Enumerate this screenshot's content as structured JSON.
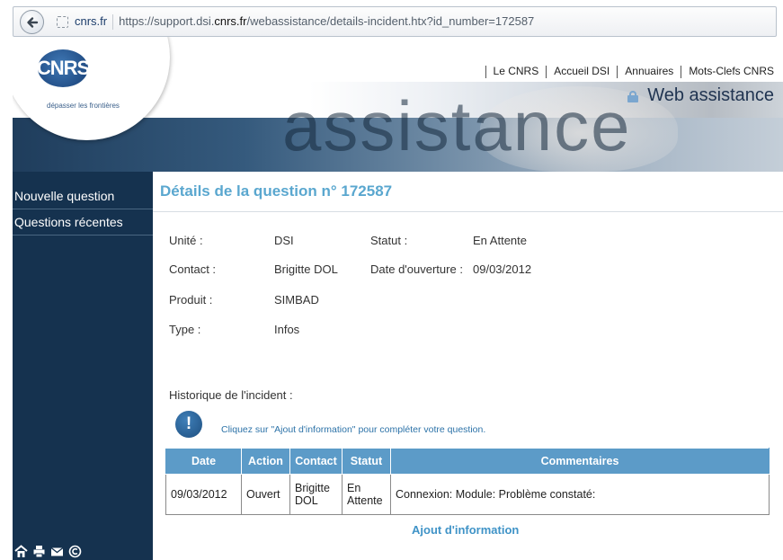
{
  "browser": {
    "domain": "cnrs.fr",
    "url_prefix": "https://support.dsi.",
    "url_bold": "cnrs.fr",
    "url_suffix": "/webassistance/details-incident.htx?id_number=172587"
  },
  "header": {
    "logo_text": "CNRS",
    "tagline": "dépasser les frontières",
    "banner_word": "assistance",
    "top_links": [
      "Le CNRS",
      "Accueil DSI",
      "Annuaires",
      "Mots-Clefs CNRS"
    ],
    "app_title": "Web assistance"
  },
  "sidebar": {
    "items": [
      {
        "label": "Nouvelle question"
      },
      {
        "label": "Questions récentes"
      }
    ],
    "footer_icons": [
      "home-icon",
      "print-icon",
      "mail-icon",
      "copyright-icon"
    ]
  },
  "main": {
    "title": "Détails de la question n° 172587",
    "fields": {
      "unite_label": "Unité :",
      "unite_value": "DSI",
      "statut_label": "Statut :",
      "statut_value": "En Attente",
      "contact_label": "Contact :",
      "contact_value": "Brigitte DOL",
      "ouverture_label": "Date d'ouverture :",
      "ouverture_value": "09/03/2012",
      "produit_label": "Produit :",
      "produit_value": "SIMBAD",
      "type_label": "Type :",
      "type_value": "Infos"
    },
    "history_label": "Historique de l'incident :",
    "info_message": "Cliquez sur \"Ajout d'information\" pour compléter votre question.",
    "table": {
      "headers": [
        "Date",
        "Action",
        "Contact",
        "Statut",
        "Commentaires"
      ],
      "rows": [
        {
          "date": "09/03/2012",
          "action": "Ouvert",
          "contact_line1": "Brigitte",
          "contact_line2": "DOL",
          "statut_line1": "En",
          "statut_line2": "Attente",
          "commentaire": "Connexion: Module: Problème constaté:"
        }
      ]
    },
    "add_info_label": "Ajout d'information"
  },
  "colors": {
    "sidebar_bg": "#15324f",
    "title_color": "#5aa7cf",
    "table_header_bg": "#5c9bc8",
    "link_color": "#3f93c7"
  }
}
